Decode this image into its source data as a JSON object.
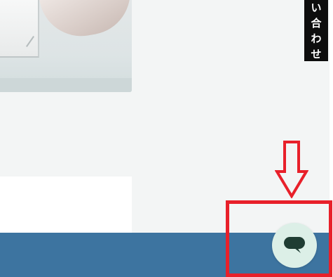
{
  "contact_tab": {
    "chars": [
      "い",
      "合",
      "わ",
      "せ"
    ]
  },
  "colors": {
    "page_background": "#f3f5f5",
    "footer_band": "#3d74a0",
    "annotation_red": "#e8202a",
    "chat_button_bg": "#dcefe7",
    "chat_icon": "#1f3d33",
    "contact_tab_bg": "#0d0d0d"
  },
  "icons": {
    "chat": "chat-bubble-icon",
    "annotation_arrow": "down-arrow-icon"
  }
}
